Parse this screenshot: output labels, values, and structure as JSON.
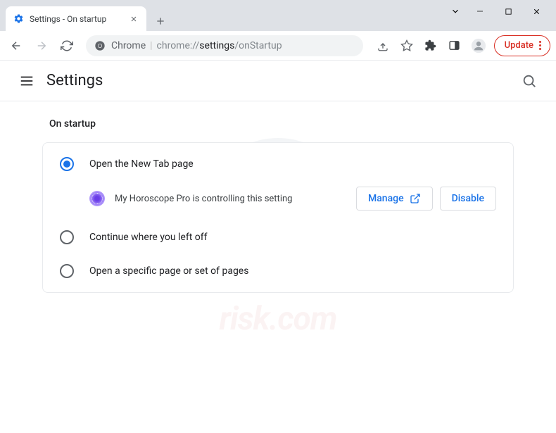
{
  "tab": {
    "title": "Settings - On startup"
  },
  "omnibox": {
    "scheme": "Chrome",
    "host": "chrome://",
    "path1": "settings",
    "path2": "/onStartup"
  },
  "toolbar": {
    "update_label": "Update"
  },
  "settings": {
    "title": "Settings",
    "section_title": "On startup",
    "options": {
      "new_tab": "Open the New Tab page",
      "continue": "Continue where you left off",
      "specific": "Open a specific page or set of pages"
    },
    "controlled_by": "My Horoscope Pro is controlling this setting",
    "manage_label": "Manage",
    "disable_label": "Disable"
  },
  "watermark": {
    "text": "risk.com"
  }
}
